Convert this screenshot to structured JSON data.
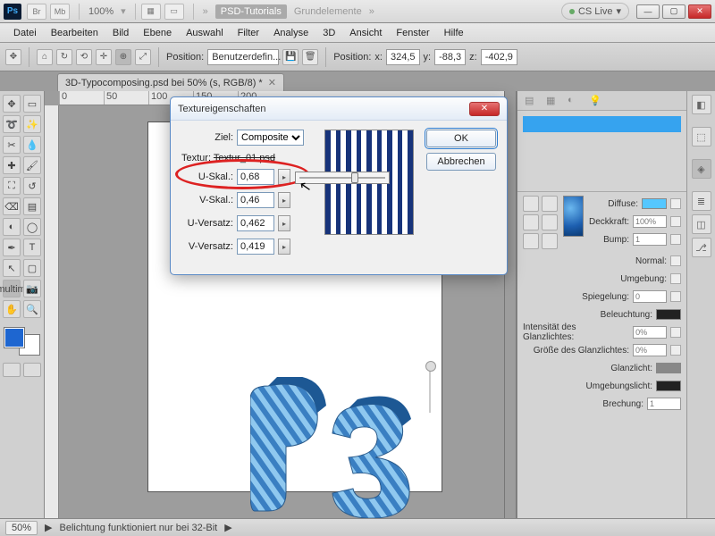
{
  "app": {
    "logo": "Ps",
    "br": "Br",
    "mb": "Mb",
    "zoom": "100%",
    "crumbs": [
      "PSD-Tutorials",
      "Grundelemente"
    ],
    "cslive": "CS Live"
  },
  "menu": [
    "Datei",
    "Bearbeiten",
    "Bild",
    "Ebene",
    "Auswahl",
    "Filter",
    "Analyse",
    "3D",
    "Ansicht",
    "Fenster",
    "Hilfe"
  ],
  "opt": {
    "position_label": "Position:",
    "position_dd": "Benutzerdefin...",
    "pos2": "Position:",
    "x": "x:",
    "xv": "324,5",
    "y": "y:",
    "yv": "-88,3",
    "z": "z:",
    "zv": "-402,9"
  },
  "tab": {
    "title": "3D-Typocomposing.psd bei 50% (s, RGB/8) *"
  },
  "ruler": [
    "0",
    "50",
    "100",
    "150",
    "200"
  ],
  "status": {
    "zoom": "50%",
    "msg": "Belichtung funktioniert nur bei 32-Bit"
  },
  "dialog": {
    "title": "Textureigenschaften",
    "ziel_label": "Ziel:",
    "ziel_value": "Composite",
    "textur_label": "Textur:",
    "textur_file": "Textur_01.psd",
    "u_skal_label": "U-Skal.:",
    "u_skal": "0,68",
    "v_skal_label": "V-Skal.:",
    "v_skal": "0,46",
    "u_off_label": "U-Versatz:",
    "u_off": "0,462",
    "v_off_label": "V-Versatz:",
    "v_off": "0,419",
    "ok": "OK",
    "cancel": "Abbrechen"
  },
  "mat": {
    "diffuse": "Diffuse:",
    "diffuse_color": "#55c7ff",
    "deck": "Deckkraft:",
    "deck_v": "100%",
    "bump": "Bump:",
    "bump_v": "1",
    "normal": "Normal:",
    "umg": "Umgebung:",
    "spieg": "Spiegelung:",
    "spieg_v": "0",
    "bel": "Beleuchtung:",
    "intgl": "Intensität des Glanzlichtes:",
    "intgl_v": "0%",
    "grgl": "Größe des Glanzlichtes:",
    "grgl_v": "0%",
    "glanz": "Glanzlicht:",
    "umgl": "Umgebungslicht:",
    "brech": "Brechung:",
    "brech_v": "1"
  }
}
